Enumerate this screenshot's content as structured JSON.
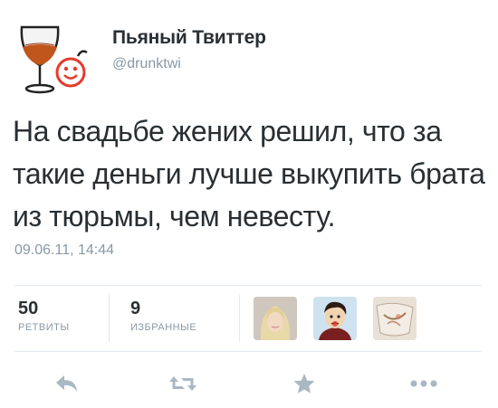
{
  "tweet": {
    "author_name": "Пьяный Твиттер",
    "handle": "@drunktwi",
    "text": "На свадьбе жених решил, что за такие деньги лучше выкупить брата из тюрьмы, чем невесту.",
    "timestamp": "09.06.11, 14:44"
  },
  "stats": {
    "retweets_count": "50",
    "retweets_label": "РЕТВИТЫ",
    "favorites_count": "9",
    "favorites_label": "ИЗБРАННЫЕ"
  },
  "favoriters": [
    "avatar-blonde-woman",
    "avatar-cartoon-man",
    "avatar-sketch"
  ],
  "actions": [
    "reply-icon",
    "retweet-icon",
    "favorite-icon",
    "more-icon"
  ],
  "colors": {
    "text": "#292f33",
    "muted": "#8899a6",
    "border": "#e1e8ed",
    "logo_red": "#e53b2c",
    "glass_drink": "#c0561b"
  }
}
